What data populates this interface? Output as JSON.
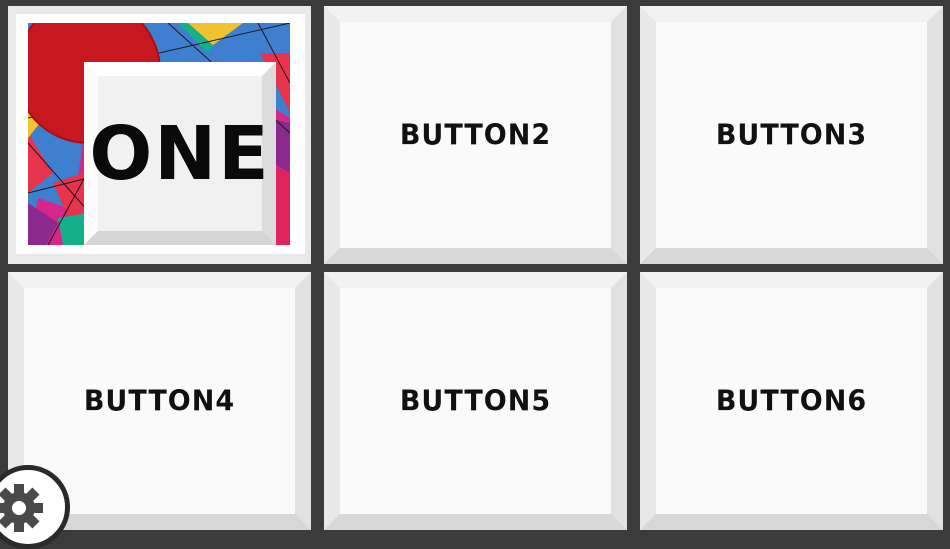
{
  "buttons": [
    {
      "id": 1,
      "label": "ONE"
    },
    {
      "id": 2,
      "label": "BUTTON2"
    },
    {
      "id": 3,
      "label": "BUTTON3"
    },
    {
      "id": 4,
      "label": "BUTTON4"
    },
    {
      "id": 5,
      "label": "BUTTON5"
    },
    {
      "id": 6,
      "label": "BUTTON6"
    }
  ],
  "settings": {
    "icon": "gear-icon"
  },
  "colors": {
    "background": "#3b3b3b",
    "button_face": "#fafafa",
    "art_red": "#c7181f",
    "art_blue": "#3f7fd0",
    "art_magenta": "#d6268a",
    "art_teal": "#14b08a",
    "art_yellow": "#f2c230"
  }
}
